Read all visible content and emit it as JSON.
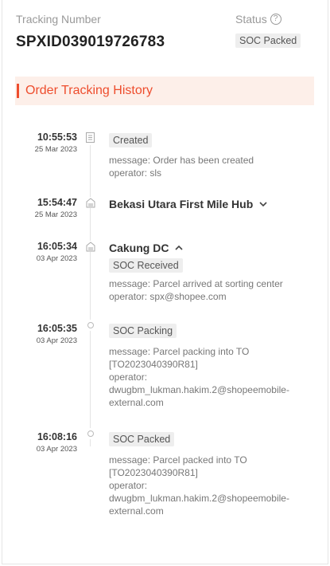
{
  "header": {
    "tracking_label": "Tracking Number",
    "tracking_number": "SPXID039019726783",
    "status_label": "Status",
    "status_value": "SOC Packed"
  },
  "history": {
    "title": "Order Tracking History"
  },
  "events": [
    {
      "time": "10:55:53",
      "date": "25 Mar 2023",
      "badge": "Created",
      "message": "message: Order has been created",
      "operator": "operator: sls",
      "icon": "document-icon"
    },
    {
      "time": "15:54:47",
      "date": "25 Mar 2023",
      "title": "Bekasi Utara First Mile Hub",
      "icon": "warehouse-icon",
      "toggle": "chevron-down-icon"
    },
    {
      "time": "16:05:34",
      "date": "03 Apr 2023",
      "title": "Cakung DC",
      "badge": "SOC Received",
      "message": "message: Parcel arrived at sorting center",
      "operator": "operator: spx@shopee.com",
      "icon": "warehouse-icon",
      "toggle": "chevron-up-icon"
    },
    {
      "time": "16:05:35",
      "date": "03 Apr 2023",
      "badge": "SOC Packing",
      "message_lines": [
        "message: Parcel packing into TO",
        "[TO2023040390R81]"
      ],
      "operator_lines": [
        "operator:",
        "dwugbm_lukman.hakim.2@shopeemobile-",
        "external.com"
      ]
    },
    {
      "time": "16:08:16",
      "date": "03 Apr 2023",
      "badge": "SOC Packed",
      "message_lines": [
        "message: Parcel packed into TO",
        "[TO2023040390R81]"
      ],
      "operator_lines": [
        "operator:",
        "dwugbm_lukman.hakim.2@shopeemobile-",
        "external.com"
      ]
    }
  ]
}
